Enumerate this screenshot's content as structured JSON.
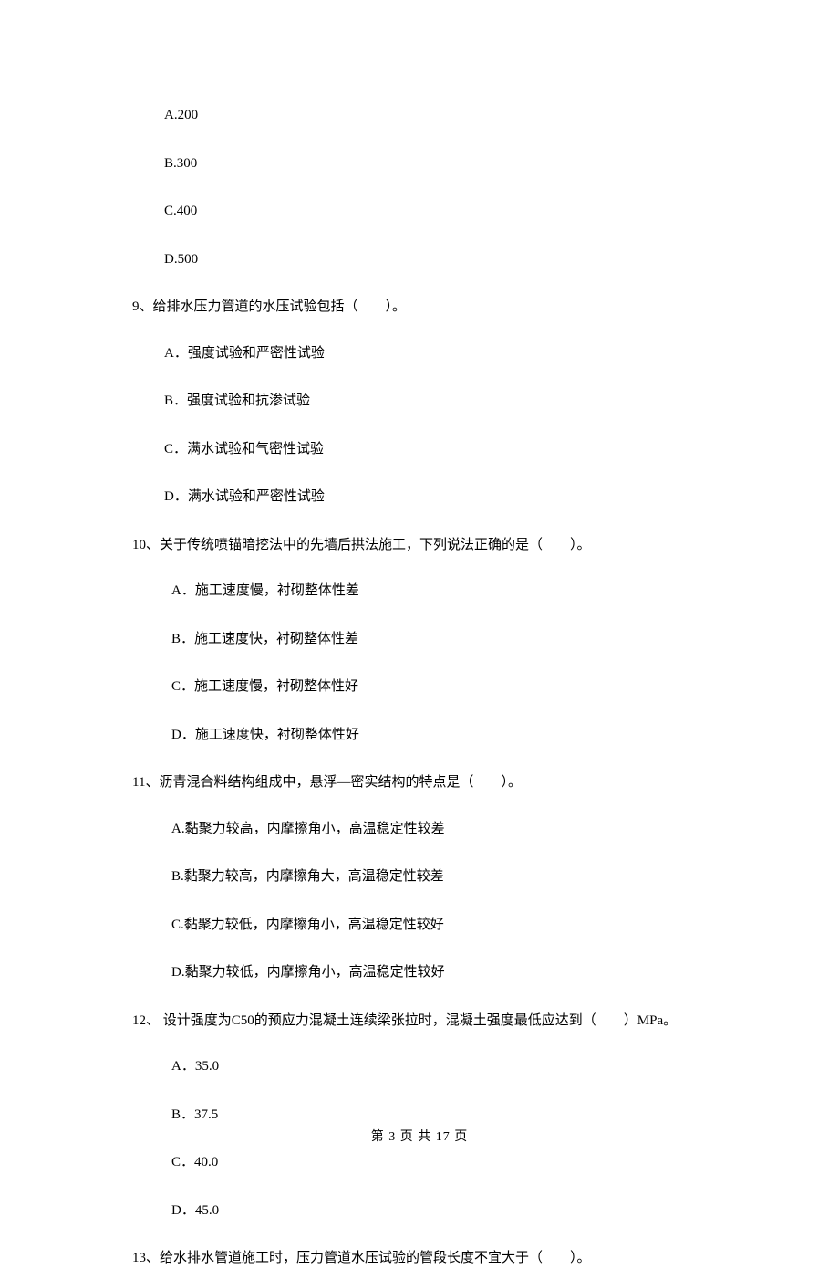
{
  "q8_options": {
    "a": "A.200",
    "b": "B.300",
    "c": "C.400",
    "d": "D.500"
  },
  "q9": {
    "text": "9、给排水压力管道的水压试验包括（　　）。",
    "a": "A．强度试验和严密性试验",
    "b": "B．强度试验和抗渗试验",
    "c": "C．满水试验和气密性试验",
    "d": "D．满水试验和严密性试验"
  },
  "q10": {
    "text": "10、关于传统喷锚暗挖法中的先墙后拱法施工，下列说法正确的是（　　）。",
    "a": "A．施工速度慢，衬砌整体性差",
    "b": "B．施工速度快，衬砌整体性差",
    "c": "C．施工速度慢，衬砌整体性好",
    "d": "D．施工速度快，衬砌整体性好"
  },
  "q11": {
    "text": "11、沥青混合料结构组成中，悬浮—密实结构的特点是（　　）。",
    "a": "A.黏聚力较高，内摩擦角小，高温稳定性较差",
    "b": "B.黏聚力较高，内摩擦角大，高温稳定性较差",
    "c": "C.黏聚力较低，内摩擦角小，高温稳定性较好",
    "d": "D.黏聚力较低，内摩擦角小，高温稳定性较好"
  },
  "q12": {
    "text": "12、 设计强度为C50的预应力混凝土连续梁张拉时，混凝土强度最低应达到（　　）MPa。",
    "a": "A．35.0",
    "b": "B．37.5",
    "c": "C．40.0",
    "d": "D．45.0"
  },
  "q13": {
    "text": "13、给水排水管道施工时，压力管道水压试验的管段长度不宜大于（　　）。"
  },
  "footer": "第 3 页 共 17 页"
}
